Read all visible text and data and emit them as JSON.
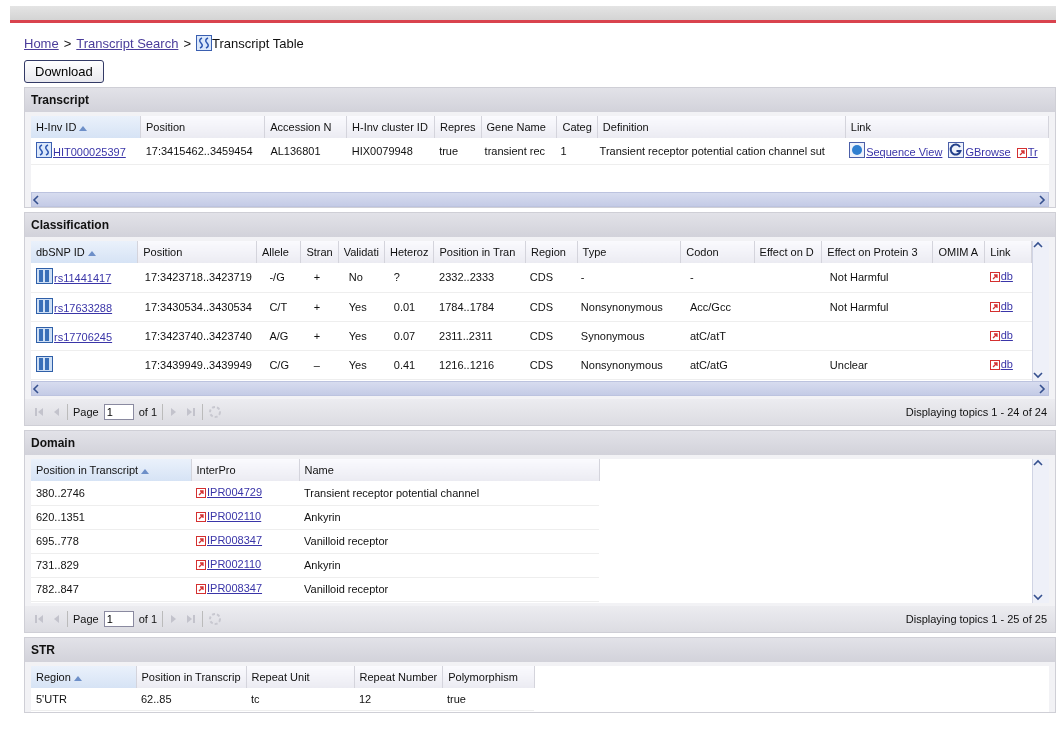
{
  "breadcrumb": [
    {
      "kind": "link",
      "text": "Home"
    },
    {
      "kind": "separator",
      "text": ">"
    },
    {
      "kind": "link",
      "text": "Transcript Search"
    },
    {
      "kind": "separator",
      "text": ">"
    },
    {
      "kind": "current",
      "text": "Transcript Table"
    }
  ],
  "download_button": "Download",
  "panels": [
    {
      "title": "Transcript",
      "columns": [
        {
          "label": "H-Inv ID",
          "sorted": true
        },
        {
          "label": "Position",
          "sorted": false
        },
        {
          "label": "Accession N",
          "sorted": false
        },
        {
          "label": "H-Inv cluster ID",
          "sorted": false
        },
        {
          "label": "Repres",
          "sorted": false
        },
        {
          "label": "Gene Name",
          "sorted": false
        },
        {
          "label": "Categ",
          "sorted": false
        },
        {
          "label": "Definition",
          "sorted": false
        },
        {
          "label": "Link",
          "sorted": false
        }
      ],
      "rows": [
        [
          {
            "kind": "ss",
            "text": "HIT000025397"
          },
          "17:3415462..3459454",
          "AL136801",
          "HIX0079948",
          "true",
          "transient rec",
          "1",
          "Transient receptor potential cation channel sut",
          {
            "kind": "links",
            "items": [
              {
                "kind": "seq",
                "text": "Sequence View"
              },
              {
                "kind": "gbrowse",
                "text": "GBrowse"
              },
              {
                "kind": "ext",
                "text": "Tr"
              }
            ]
          }
        ]
      ]
    },
    {
      "title": "Classification",
      "columns": [
        {
          "label": "dbSNP ID",
          "sorted": true
        },
        {
          "label": "Position",
          "sorted": false
        },
        {
          "label": "Allele",
          "sorted": false
        },
        {
          "label": "Stran",
          "sorted": false
        },
        {
          "label": "Validati",
          "sorted": false
        },
        {
          "label": "Heteroz",
          "sorted": false
        },
        {
          "label": "Position in Tran",
          "sorted": false
        },
        {
          "label": "Region",
          "sorted": false
        },
        {
          "label": "Type",
          "sorted": false
        },
        {
          "label": "Codon",
          "sorted": false
        },
        {
          "label": "Effect on D",
          "sorted": false
        },
        {
          "label": "Effect on Protein 3",
          "sorted": false
        },
        {
          "label": "OMIM A",
          "sorted": false
        },
        {
          "label": "Link",
          "sorted": false
        }
      ],
      "rows": [
        [
          {
            "kind": "snp",
            "text": "rs11441417"
          },
          "17:3423718..3423719",
          "-/G",
          "+",
          "No",
          "?",
          "2332..2333",
          "CDS",
          "-",
          "-",
          "",
          "Not Harmful",
          "",
          {
            "kind": "ext",
            "text": "db"
          }
        ],
        [
          {
            "kind": "snp",
            "text": "rs17633288"
          },
          "17:3430534..3430534",
          "C/T",
          "+",
          "Yes",
          "0.01",
          "1784..1784",
          "CDS",
          "Nonsynonymous",
          "Acc/Gcc",
          "",
          "Not Harmful",
          "",
          {
            "kind": "ext",
            "text": "db"
          }
        ],
        [
          {
            "kind": "snp",
            "text": "rs17706245"
          },
          "17:3423740..3423740",
          "A/G",
          "+",
          "Yes",
          "0.07",
          "2311..2311",
          "CDS",
          "Synonymous",
          "atC/atT",
          "",
          "",
          "",
          {
            "kind": "ext",
            "text": "db"
          }
        ],
        [
          {
            "kind": "snp"
          },
          "17:3439949..3439949",
          "C/G",
          "–",
          "Yes",
          "0.41",
          "1216..1216",
          "CDS",
          "Nonsynonymous",
          "atC/atG",
          "",
          "Unclear",
          "",
          {
            "kind": "ext",
            "text": "db"
          }
        ]
      ],
      "pager": {
        "page_label": "Page",
        "page": "1",
        "of": "of 1",
        "summary": "Displaying topics 1 - 24 of 24"
      }
    },
    {
      "title": "Domain",
      "columns": [
        {
          "label": "Position in Transcript",
          "sorted": true
        },
        {
          "label": "InterPro",
          "sorted": false
        },
        {
          "label": "Name",
          "sorted": false
        }
      ],
      "rows": [
        [
          "380..2746",
          {
            "kind": "ext",
            "text": "IPR004729"
          },
          "Transient receptor potential channel"
        ],
        [
          "620..1351",
          {
            "kind": "ext",
            "text": "IPR002110"
          },
          "Ankyrin"
        ],
        [
          "695..778",
          {
            "kind": "ext",
            "text": "IPR008347"
          },
          "Vanilloid receptor"
        ],
        [
          "731..829",
          {
            "kind": "ext",
            "text": "IPR002110"
          },
          "Ankyrin"
        ],
        [
          "782..847",
          {
            "kind": "ext",
            "text": "IPR008347"
          },
          "Vanilloid receptor"
        ]
      ],
      "pager": {
        "page_label": "Page",
        "page": "1",
        "of": "of 1",
        "summary": "Displaying topics 1 - 25 of 25"
      }
    },
    {
      "title": "STR",
      "columns": [
        {
          "label": "Region",
          "sorted": true
        },
        {
          "label": "Position in Transcrip",
          "sorted": false
        },
        {
          "label": "Repeat Unit",
          "sorted": false
        },
        {
          "label": "Repeat Number",
          "sorted": false
        },
        {
          "label": "Polymorphism",
          "sorted": false
        }
      ],
      "rows": [
        [
          "5'UTR",
          "62..85",
          "tc",
          "12",
          "true"
        ]
      ]
    }
  ]
}
